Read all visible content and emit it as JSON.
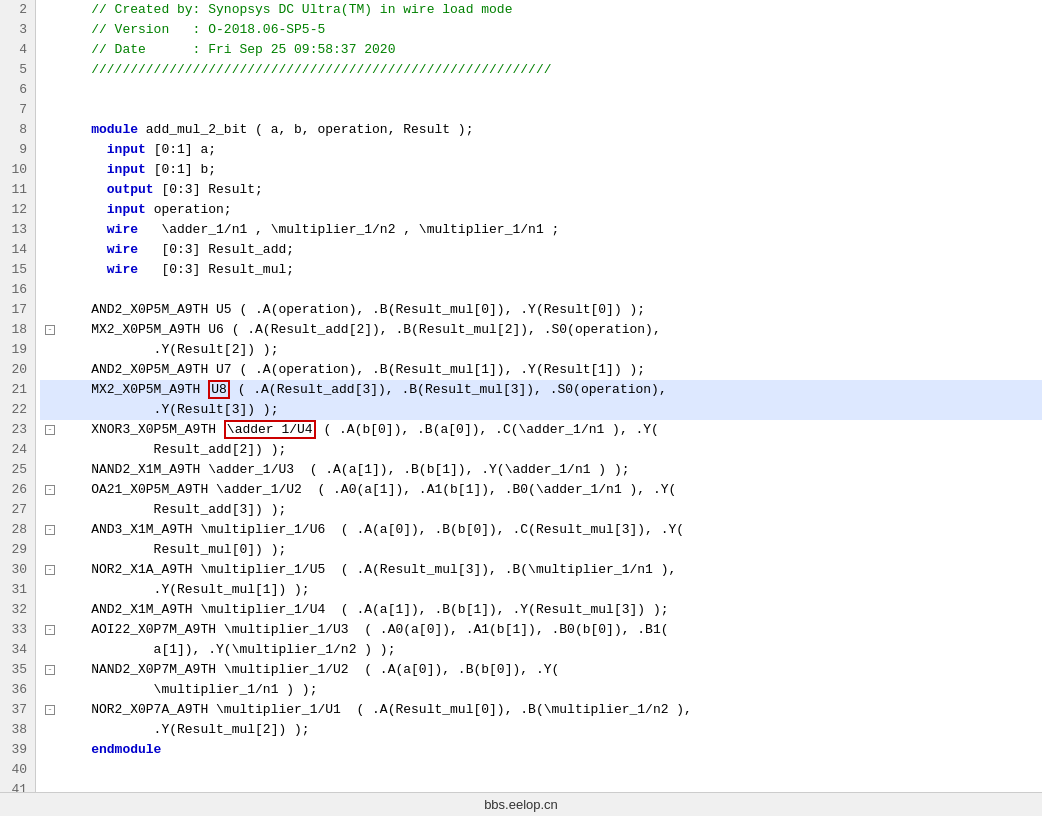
{
  "footer": {
    "text": "bbs.eelop.cn"
  },
  "lines": [
    {
      "num": 2,
      "fold": false,
      "highlighted": false,
      "content": [
        {
          "type": "cm",
          "text": "    // Created by: Synopsys DC Ultra(TM) in wire load mode"
        }
      ]
    },
    {
      "num": 3,
      "fold": false,
      "highlighted": false,
      "content": [
        {
          "type": "cm",
          "text": "    // Version   : O-2018.06-SP5-5"
        }
      ]
    },
    {
      "num": 4,
      "fold": false,
      "highlighted": false,
      "content": [
        {
          "type": "cm",
          "text": "    // Date      : Fri Sep 25 09:58:37 2020"
        }
      ]
    },
    {
      "num": 5,
      "fold": false,
      "highlighted": false,
      "content": [
        {
          "type": "cm",
          "text": "    ///////////////////////////////////////////////////////////"
        }
      ]
    },
    {
      "num": 6,
      "fold": false,
      "highlighted": false,
      "content": [
        {
          "type": "plain",
          "text": ""
        }
      ]
    },
    {
      "num": 7,
      "fold": false,
      "highlighted": false,
      "content": [
        {
          "type": "plain",
          "text": ""
        }
      ]
    },
    {
      "num": 8,
      "fold": false,
      "highlighted": false,
      "content": [
        {
          "type": "kw",
          "text": "    module"
        },
        {
          "type": "plain",
          "text": " add_mul_2_bit ( a, b, operation, Result );"
        }
      ]
    },
    {
      "num": 9,
      "fold": false,
      "highlighted": false,
      "content": [
        {
          "type": "kw",
          "text": "      input"
        },
        {
          "type": "plain",
          "text": " [0:1] a;"
        }
      ]
    },
    {
      "num": 10,
      "fold": false,
      "highlighted": false,
      "content": [
        {
          "type": "kw",
          "text": "      input"
        },
        {
          "type": "plain",
          "text": " [0:1] b;"
        }
      ]
    },
    {
      "num": 11,
      "fold": false,
      "highlighted": false,
      "content": [
        {
          "type": "kw",
          "text": "      output"
        },
        {
          "type": "plain",
          "text": " [0:3] Result;"
        }
      ]
    },
    {
      "num": 12,
      "fold": false,
      "highlighted": false,
      "content": [
        {
          "type": "kw",
          "text": "      input"
        },
        {
          "type": "plain",
          "text": " operation;"
        }
      ]
    },
    {
      "num": 13,
      "fold": false,
      "highlighted": false,
      "content": [
        {
          "type": "kw",
          "text": "      wire"
        },
        {
          "type": "plain",
          "text": "   \\adder_1/n1 , \\multiplier_1/n2 , \\multiplier_1/n1 ;"
        }
      ]
    },
    {
      "num": 14,
      "fold": false,
      "highlighted": false,
      "content": [
        {
          "type": "kw",
          "text": "      wire"
        },
        {
          "type": "plain",
          "text": "   [0:3] Result_add;"
        }
      ]
    },
    {
      "num": 15,
      "fold": false,
      "highlighted": false,
      "content": [
        {
          "type": "kw",
          "text": "      wire"
        },
        {
          "type": "plain",
          "text": "   [0:3] Result_mul;"
        }
      ]
    },
    {
      "num": 16,
      "fold": false,
      "highlighted": false,
      "content": [
        {
          "type": "plain",
          "text": ""
        }
      ]
    },
    {
      "num": 17,
      "fold": false,
      "highlighted": false,
      "content": [
        {
          "type": "plain",
          "text": "    AND2_X0P5M_A9TH U5 ( .A(operation), .B(Result_mul[0]), .Y(Result[0]) );"
        }
      ]
    },
    {
      "num": 18,
      "fold": true,
      "highlighted": false,
      "content": [
        {
          "type": "plain",
          "text": "    MX2_X0P5M_A9TH U6 ( .A(Result_add[2]), .B(Result_mul[2]), .S0(operation),"
        }
      ]
    },
    {
      "num": 19,
      "fold": false,
      "highlighted": false,
      "content": [
        {
          "type": "plain",
          "text": "            .Y(Result[2]) );"
        }
      ]
    },
    {
      "num": 20,
      "fold": false,
      "highlighted": false,
      "content": [
        {
          "type": "plain",
          "text": "    AND2_X0P5M_A9TH U7 ( .A(operation), .B(Result_mul[1]), .Y(Result[1]) );"
        }
      ]
    },
    {
      "num": 21,
      "fold": false,
      "highlighted": true,
      "content": [
        {
          "type": "plain",
          "text": "    MX2_X0P5M_A9TH "
        },
        {
          "type": "redbox",
          "text": "U8"
        },
        {
          "type": "plain",
          "text": " ( .A(Result_add[3]), .B(Result_mul[3]), .S0(operation),"
        }
      ]
    },
    {
      "num": 22,
      "fold": false,
      "highlighted": true,
      "content": [
        {
          "type": "plain",
          "text": "            .Y(Result[3]) );"
        }
      ]
    },
    {
      "num": 23,
      "fold": true,
      "highlighted": false,
      "linebox": true,
      "content": [
        {
          "type": "plain",
          "text": "    XNOR3_X0P5M_A9TH "
        },
        {
          "type": "redbox",
          "text": "\\adder 1/U4"
        },
        {
          "type": "plain",
          "text": " ( .A(b[0]), .B(a[0]), .C(\\adder_1/n1 ), .Y("
        }
      ]
    },
    {
      "num": 24,
      "fold": false,
      "highlighted": false,
      "content": [
        {
          "type": "plain",
          "text": "            Result_add[2]) );"
        }
      ]
    },
    {
      "num": 25,
      "fold": false,
      "highlighted": false,
      "content": [
        {
          "type": "plain",
          "text": "    NAND2_X1M_A9TH \\adder_1/U3  ( .A(a[1]), .B(b[1]), .Y(\\adder_1/n1 ) );"
        }
      ]
    },
    {
      "num": 26,
      "fold": true,
      "highlighted": false,
      "content": [
        {
          "type": "plain",
          "text": "    OA21_X0P5M_A9TH \\adder_1/U2  ( .A0(a[1]), .A1(b[1]), .B0(\\adder_1/n1 ), .Y("
        }
      ]
    },
    {
      "num": 27,
      "fold": false,
      "highlighted": false,
      "content": [
        {
          "type": "plain",
          "text": "            Result_add[3]) );"
        }
      ]
    },
    {
      "num": 28,
      "fold": true,
      "highlighted": false,
      "content": [
        {
          "type": "plain",
          "text": "    AND3_X1M_A9TH \\multiplier_1/U6  ( .A(a[0]), .B(b[0]), .C(Result_mul[3]), .Y("
        }
      ]
    },
    {
      "num": 29,
      "fold": false,
      "highlighted": false,
      "content": [
        {
          "type": "plain",
          "text": "            Result_mul[0]) );"
        }
      ]
    },
    {
      "num": 30,
      "fold": true,
      "highlighted": false,
      "content": [
        {
          "type": "plain",
          "text": "    NOR2_X1A_A9TH \\multiplier_1/U5  ( .A(Result_mul[3]), .B(\\multiplier_1/n1 ),"
        }
      ]
    },
    {
      "num": 31,
      "fold": false,
      "highlighted": false,
      "content": [
        {
          "type": "plain",
          "text": "            .Y(Result_mul[1]) );"
        }
      ]
    },
    {
      "num": 32,
      "fold": false,
      "highlighted": false,
      "content": [
        {
          "type": "plain",
          "text": "    AND2_X1M_A9TH \\multiplier_1/U4  ( .A(a[1]), .B(b[1]), .Y(Result_mul[3]) );"
        }
      ]
    },
    {
      "num": 33,
      "fold": true,
      "highlighted": false,
      "content": [
        {
          "type": "plain",
          "text": "    AOI22_X0P7M_A9TH \\multiplier_1/U3  ( .A0(a[0]), .A1(b[1]), .B0(b[0]), .B1("
        }
      ]
    },
    {
      "num": 34,
      "fold": false,
      "highlighted": false,
      "content": [
        {
          "type": "plain",
          "text": "            a[1]), .Y(\\multiplier_1/n2 ) );"
        }
      ]
    },
    {
      "num": 35,
      "fold": true,
      "highlighted": false,
      "content": [
        {
          "type": "plain",
          "text": "    NAND2_X0P7M_A9TH \\multiplier_1/U2  ( .A(a[0]), .B(b[0]), .Y("
        }
      ]
    },
    {
      "num": 36,
      "fold": false,
      "highlighted": false,
      "content": [
        {
          "type": "plain",
          "text": "            \\multiplier_1/n1 ) );"
        }
      ]
    },
    {
      "num": 37,
      "fold": true,
      "highlighted": false,
      "content": [
        {
          "type": "plain",
          "text": "    NOR2_X0P7A_A9TH \\multiplier_1/U1  ( .A(Result_mul[0]), .B(\\multiplier_1/n2 ),"
        }
      ]
    },
    {
      "num": 38,
      "fold": false,
      "highlighted": false,
      "content": [
        {
          "type": "plain",
          "text": "            .Y(Result_mul[2]) );"
        }
      ]
    },
    {
      "num": 39,
      "fold": false,
      "highlighted": false,
      "content": [
        {
          "type": "kw",
          "text": "    endmodule"
        }
      ]
    },
    {
      "num": 40,
      "fold": false,
      "highlighted": false,
      "content": [
        {
          "type": "plain",
          "text": ""
        }
      ]
    },
    {
      "num": 41,
      "fold": false,
      "highlighted": false,
      "content": [
        {
          "type": "plain",
          "text": ""
        }
      ]
    }
  ]
}
